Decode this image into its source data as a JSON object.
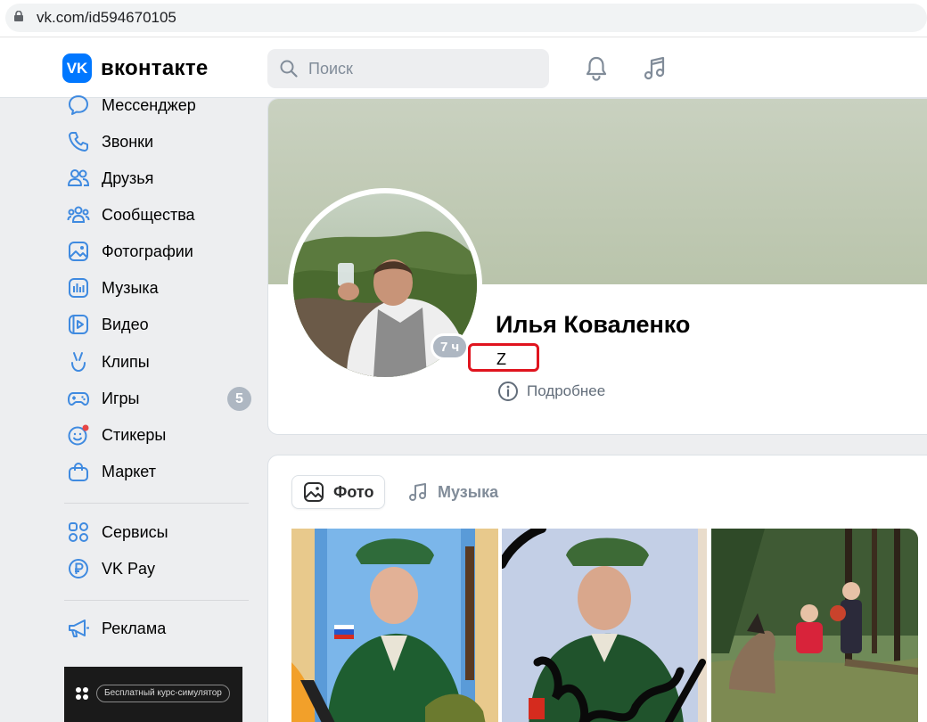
{
  "browser": {
    "url": "vk.com/id594670105"
  },
  "header": {
    "logo_mark": "VK",
    "logo_text": "вконтакте",
    "search_placeholder": "Поиск"
  },
  "sidebar": {
    "items": [
      {
        "label": "Мессенджер",
        "icon": "messenger-icon"
      },
      {
        "label": "Звонки",
        "icon": "phone-icon"
      },
      {
        "label": "Друзья",
        "icon": "friends-icon"
      },
      {
        "label": "Сообщества",
        "icon": "communities-icon"
      },
      {
        "label": "Фотографии",
        "icon": "photos-icon"
      },
      {
        "label": "Музыка",
        "icon": "music-icon"
      },
      {
        "label": "Видео",
        "icon": "video-icon"
      },
      {
        "label": "Клипы",
        "icon": "clips-icon"
      },
      {
        "label": "Игры",
        "icon": "games-icon",
        "badge": "5"
      },
      {
        "label": "Стикеры",
        "icon": "stickers-icon"
      },
      {
        "label": "Маркет",
        "icon": "market-icon"
      },
      {
        "label": "Сервисы",
        "icon": "services-icon"
      },
      {
        "label": "VK Pay",
        "icon": "vkpay-icon"
      },
      {
        "label": "Реклама",
        "icon": "ads-icon"
      }
    ],
    "promo_text": "Бесплатный курс-симулятор"
  },
  "profile": {
    "name": "Илья Коваленко",
    "status": "Z",
    "last_seen": "7 ч",
    "more_label": "Подробнее"
  },
  "media": {
    "tabs": [
      {
        "label": "Фото",
        "active": true
      },
      {
        "label": "Музыка",
        "active": false
      }
    ]
  },
  "colors": {
    "accent": "#0077ff",
    "highlight_border": "#e0141e",
    "badge": "#aeb7c2"
  }
}
